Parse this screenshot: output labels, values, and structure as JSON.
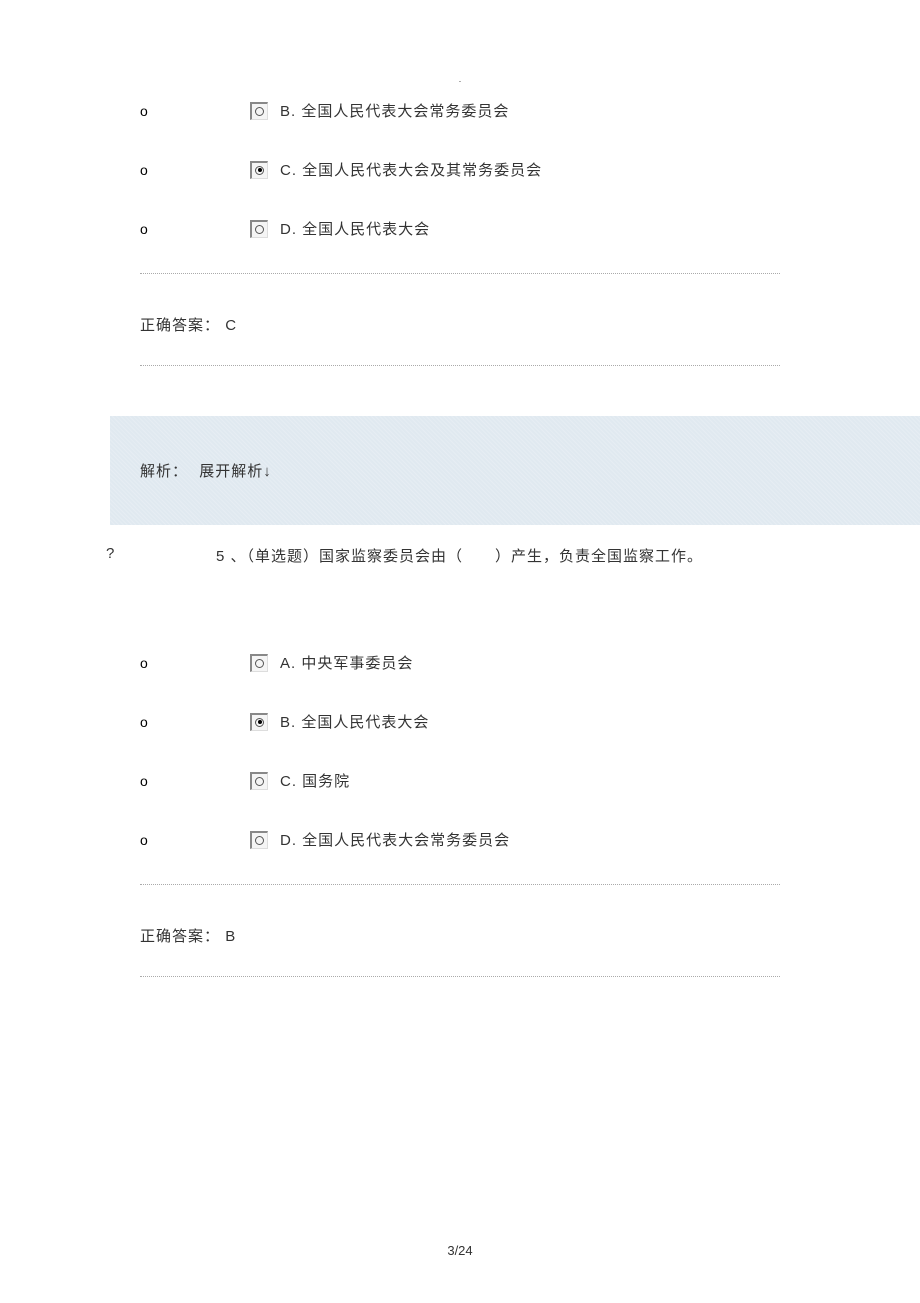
{
  "page_dot": ".",
  "q4": {
    "options": [
      {
        "letter": "B.",
        "text": "全国人民代表大会常务委员会",
        "selected": false
      },
      {
        "letter": "C.",
        "text": "全国人民代表大会及其常务委员会",
        "selected": true
      },
      {
        "letter": "D.",
        "text": "全国人民代表大会",
        "selected": false
      }
    ],
    "answer_label": "正确答案：",
    "answer": "C"
  },
  "explain": {
    "label": "解析：",
    "text": "展开解析↓"
  },
  "q5": {
    "marker": "?",
    "number": "5 、",
    "type": "（单选题）",
    "stem": "国家监察委员会由（　　）产生，负责全国监察工作。",
    "options": [
      {
        "letter": "A.",
        "text": "中央军事委员会",
        "selected": false
      },
      {
        "letter": "B.",
        "text": "全国人民代表大会",
        "selected": true
      },
      {
        "letter": "C.",
        "text": "国务院",
        "selected": false
      },
      {
        "letter": "D.",
        "text": "全国人民代表大会常务委员会",
        "selected": false
      }
    ],
    "answer_label": "正确答案：",
    "answer": "B"
  },
  "page_num": "3/24",
  "bullet": "o"
}
